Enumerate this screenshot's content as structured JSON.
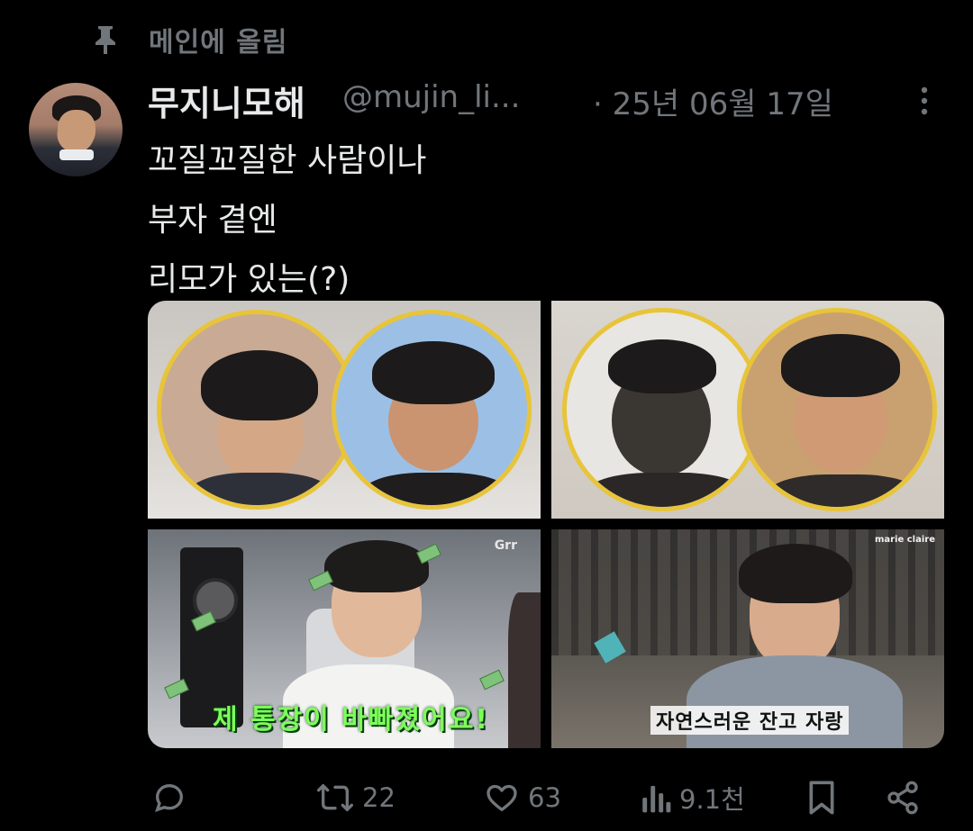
{
  "pinned": {
    "icon": "pin-icon",
    "label": "메인에 올림"
  },
  "tweet": {
    "author_name": "무지니모해",
    "handle": "@mujin_li...",
    "date": "· 25년 06월 17일",
    "text_lines": [
      "꼬질꼬질한 사람이나",
      "부자 곁엔",
      "리모가 있는(?)"
    ]
  },
  "media": {
    "tile1": {
      "type": "photo"
    },
    "tile2": {
      "type": "photo"
    },
    "tile3": {
      "overlay_text": "제 통장이 바빠졌어요!",
      "corner_tag": "Grr"
    },
    "tile4": {
      "overlay_text": "자연스러운 잔고 자랑",
      "corner_tag": "marie claire"
    }
  },
  "actions": {
    "reply": {
      "icon": "reply-icon"
    },
    "retweet": {
      "icon": "retweet-icon",
      "count": "22"
    },
    "like": {
      "icon": "heart-icon",
      "count": "63"
    },
    "views": {
      "icon": "views-icon",
      "count": "9.1천"
    },
    "bookmark": {
      "icon": "bookmark-icon"
    },
    "share": {
      "icon": "share-icon"
    }
  },
  "colors": {
    "background": "#000000",
    "text": "#e7e9ea",
    "muted": "#71767b",
    "frame": "#e8c43a"
  }
}
